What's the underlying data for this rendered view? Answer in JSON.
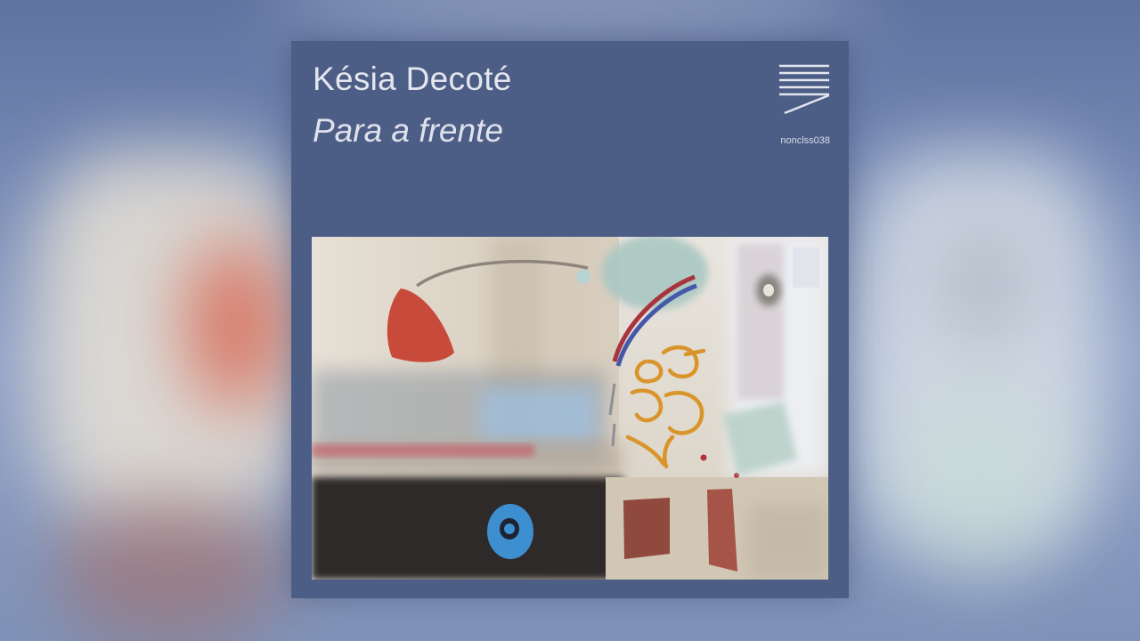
{
  "cover": {
    "artist": "Késia Decoté",
    "album": "Para a frente",
    "catalog_number": "nonclss038",
    "logo_icon": "label-stripes-logo"
  },
  "colors": {
    "cover_background": "#4d5e86",
    "page_background": "#6b7ea8",
    "text": "#e4e6ee"
  }
}
